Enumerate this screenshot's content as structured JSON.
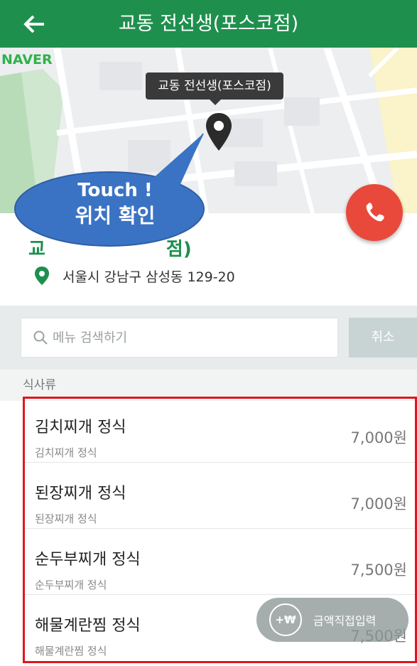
{
  "header": {
    "title": "교동 전선생(포스코점)",
    "back_icon": "arrow-left-icon",
    "background": "#1f8f4e"
  },
  "map": {
    "provider_logo": "NAVER",
    "tooltip": "교동 전선생(포스코점)",
    "pin_icon": "map-pin-icon"
  },
  "callout": {
    "line1": "Touch !",
    "line2": "위치 확인",
    "color": "#3b73c4"
  },
  "call_button": {
    "icon": "phone-icon",
    "color": "#e9493a"
  },
  "store": {
    "name_visible": "교",
    "name_tail": "점)",
    "address": "서울시 강남구 삼성동 129-20"
  },
  "search": {
    "placeholder": "메뉴 검색하기",
    "cancel_label": "취소"
  },
  "category": "식사류",
  "menu": [
    {
      "name": "김치찌개 정식",
      "desc": "김치찌개 정식",
      "price": "7,000원"
    },
    {
      "name": "된장찌개 정식",
      "desc": "된장찌개 정식",
      "price": "7,000원"
    },
    {
      "name": "순두부찌개 정식",
      "desc": "순두부찌개 정식",
      "price": "7,500원"
    },
    {
      "name": "해물계란찜 정식",
      "desc": "해물계란찜 정식",
      "price": "7,500원"
    }
  ],
  "float_button": {
    "icon_text": "+₩",
    "label": "금액직접입력"
  },
  "accent": "#e0161d"
}
